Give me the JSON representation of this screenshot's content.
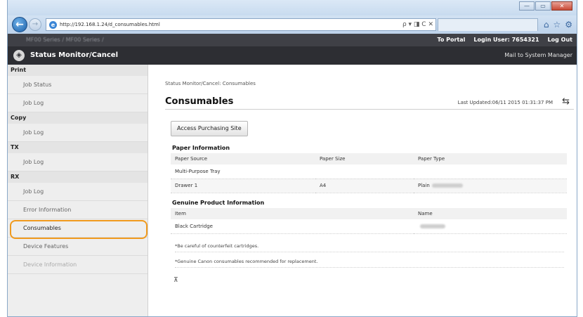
{
  "browser": {
    "url": "http://192.168.1.24/d_consumables.html",
    "url_controls": "ρ ▾ ◨ C ✕",
    "right_icons": [
      "⌂",
      "☆",
      "⚙"
    ],
    "window_buttons": [
      "—",
      "▭",
      "✕"
    ]
  },
  "header": {
    "model_label": "MF00 Series / MF00 Series /",
    "to_portal": "To Portal",
    "login_user_label": "Login User:",
    "login_user_id": "7654321",
    "logout": "Log Out",
    "app_title": "Status Monitor/Cancel",
    "mail_link": "Mail to System Manager"
  },
  "sidebar": {
    "sections": [
      {
        "label": "Print",
        "items": [
          "Job Status",
          "Job Log"
        ]
      },
      {
        "label": "Copy",
        "items": [
          "Job Log"
        ]
      },
      {
        "label": "TX",
        "items": [
          "Job Log"
        ]
      },
      {
        "label": "RX",
        "items": [
          "Job Log"
        ]
      }
    ],
    "extra_items": [
      "Error Information",
      "Consumables",
      "Device Features",
      "Device Information"
    ],
    "active": "Consumables"
  },
  "main": {
    "breadcrumb": "Status Monitor/Cancel: Consumables",
    "title": "Consumables",
    "last_updated": "Last Updated:06/11 2015 01:31:37 PM",
    "purchase_button": "Access Purchasing Site",
    "paper_info": {
      "heading": "Paper Information",
      "columns": [
        "Paper Source",
        "Paper Size",
        "Paper Type"
      ],
      "rows": [
        [
          "Multi-Purpose Tray",
          "",
          ""
        ],
        [
          "Drawer 1",
          "A4",
          "Plain"
        ]
      ]
    },
    "product_info": {
      "heading": "Genuine Product Information",
      "columns": [
        "Item",
        "Name"
      ],
      "rows": [
        [
          "Black Cartridge",
          ""
        ]
      ]
    },
    "notes": [
      "*Be careful of counterfeit cartridges.",
      "*Genuine Canon consumables recommended for replacement."
    ],
    "top_arrow": "⊼"
  }
}
